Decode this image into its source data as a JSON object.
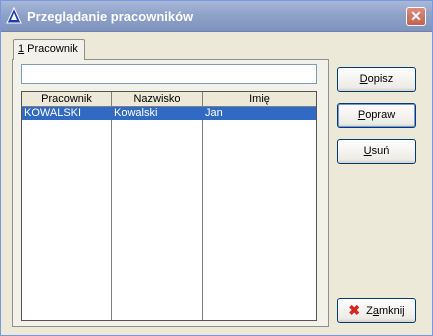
{
  "window": {
    "title": "Przeglądanie pracowników",
    "close_glyph": "✕",
    "app_icon": "triangle-app-icon",
    "close_icon": "close-icon"
  },
  "tabs": [
    {
      "accel": "1",
      "label": " Pracownik"
    }
  ],
  "search": {
    "value": ""
  },
  "grid": {
    "columns": [
      "Pracownik",
      "Nazwisko",
      "Imię"
    ],
    "rows": [
      [
        "KOWALSKI",
        "Kowalski",
        "Jan"
      ]
    ],
    "selection_color": "#316ac5"
  },
  "buttons": {
    "dopisz": {
      "accel": "D",
      "rest": "opisz"
    },
    "popraw": {
      "accel": "P",
      "rest": "opraw"
    },
    "usun": {
      "accel": "U",
      "rest": "suń"
    },
    "zamknij": {
      "pre": "Z",
      "accel": "a",
      "rest": "mknij",
      "icon": "close-x-icon"
    }
  }
}
